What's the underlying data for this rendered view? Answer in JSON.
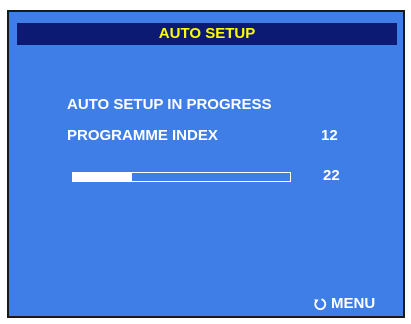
{
  "colors": {
    "screen_background": "#3f7ee6",
    "title_bar_background": "#0d1a73",
    "title_text": "#ffff00",
    "text": "#ffffff"
  },
  "header": {
    "title": "AUTO SETUP"
  },
  "main": {
    "status_text": "AUTO SETUP IN PROGRESS",
    "programme_index_label": "PROGRAMME INDEX",
    "programme_index_value": "12",
    "progress_value": "22",
    "progress_fraction": 0.27
  },
  "footer": {
    "menu_label": "MENU",
    "menu_icon": "return-arrow-icon"
  }
}
